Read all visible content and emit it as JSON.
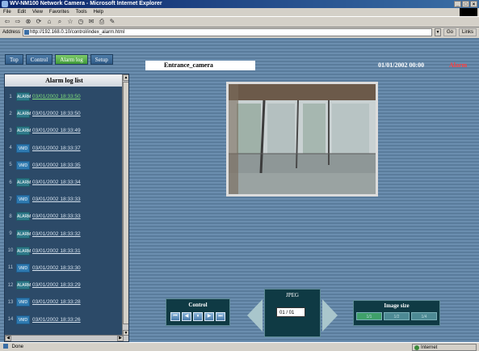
{
  "window": {
    "title": "WV-NM100 Network Camera - Microsoft Internet Explorer"
  },
  "menu": [
    "File",
    "Edit",
    "View",
    "Favorites",
    "Tools",
    "Help"
  ],
  "address": {
    "label": "Address",
    "url": "http://192.168.0.10/control/index_alarm.html",
    "go": "Go",
    "links": "Links"
  },
  "tabs": [
    {
      "label": "Top",
      "active": false
    },
    {
      "label": "Control",
      "active": false
    },
    {
      "label": "Alarm log",
      "active": true
    },
    {
      "label": "Setup",
      "active": false
    }
  ],
  "header": {
    "camera_name": "Entrance_camera",
    "datetime": "01/01/2002 00:00",
    "alarm": "Alarm"
  },
  "alarm_log": {
    "title": "Alarm log list",
    "items": [
      {
        "idx": "1",
        "type": "ALARM",
        "time": "03/01/2002 18:33:50"
      },
      {
        "idx": "2",
        "type": "ALARM",
        "time": "03/01/2002 18:33:50"
      },
      {
        "idx": "3",
        "type": "ALARM",
        "time": "03/01/2002 18:33:49"
      },
      {
        "idx": "4",
        "type": "VMD",
        "time": "03/01/2002 18:33:37"
      },
      {
        "idx": "5",
        "type": "VMD",
        "time": "03/01/2002 18:33:35"
      },
      {
        "idx": "6",
        "type": "ALARM",
        "time": "03/01/2002 18:33:34"
      },
      {
        "idx": "7",
        "type": "VMD",
        "time": "03/01/2002 18:33:33"
      },
      {
        "idx": "8",
        "type": "ALARM",
        "time": "03/01/2002 18:33:33"
      },
      {
        "idx": "9",
        "type": "ALARM",
        "time": "03/01/2002 18:33:32"
      },
      {
        "idx": "10",
        "type": "ALARM",
        "time": "03/01/2002 18:33:31"
      },
      {
        "idx": "11",
        "type": "VMD",
        "time": "03/01/2002 18:33:30"
      },
      {
        "idx": "12",
        "type": "ALARM",
        "time": "03/01/2002 18:33:29"
      },
      {
        "idx": "13",
        "type": "VMD",
        "time": "03/01/2002 18:33:28"
      },
      {
        "idx": "14",
        "type": "VMD",
        "time": "03/01/2002 18:33:26"
      }
    ]
  },
  "controls": {
    "control_label": "Control",
    "buttons": [
      "⏮",
      "◀",
      "⏸",
      "▶",
      "⏭"
    ],
    "format_label": "JPEG",
    "page": "01 / 01",
    "image_size_label": "Image size",
    "sizes": [
      {
        "label": "1/1",
        "active": true
      },
      {
        "label": "1/2",
        "active": false
      },
      {
        "label": "1/4",
        "active": false
      }
    ]
  },
  "status": {
    "text": "Done",
    "zone": "Internet"
  }
}
